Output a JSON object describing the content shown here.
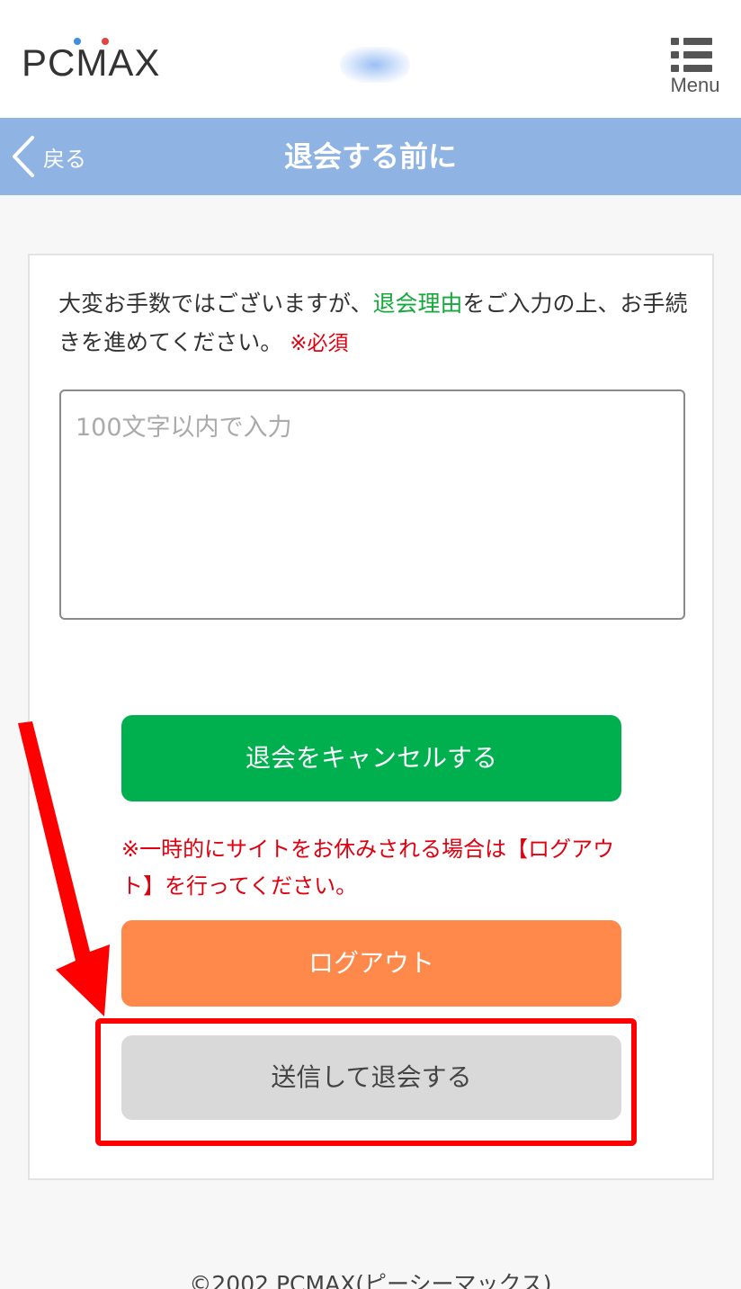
{
  "header": {
    "logo_text": "PCMAX",
    "menu_label": "Menu"
  },
  "titlebar": {
    "back_label": "戻る",
    "title": "退会する前に"
  },
  "form": {
    "intro_part1": "大変お手数ではございますが、",
    "intro_highlight": "退会理由",
    "intro_part2": "をご入力の上、お手続きを進めてください。",
    "required_label": "※必須",
    "reason_placeholder": "100文字以内で入力",
    "reason_value": ""
  },
  "actions": {
    "cancel_label": "退会をキャンセルする",
    "note": "※一時的にサイトをお休みされる場合は【ログアウト】を行ってください。",
    "logout_label": "ログアウト",
    "withdraw_label": "送信して退会する"
  },
  "footer": {
    "copyright": "©2002 PCMAX(ピーシーマックス)"
  },
  "colors": {
    "titlebar": "#8fb4e3",
    "cancel_button": "#00b04f",
    "logout_button": "#ff894a",
    "withdraw_button": "#d9d9d9",
    "highlight": "#ff0000",
    "required_text": "#e0000f",
    "link_green": "#16a83c"
  }
}
